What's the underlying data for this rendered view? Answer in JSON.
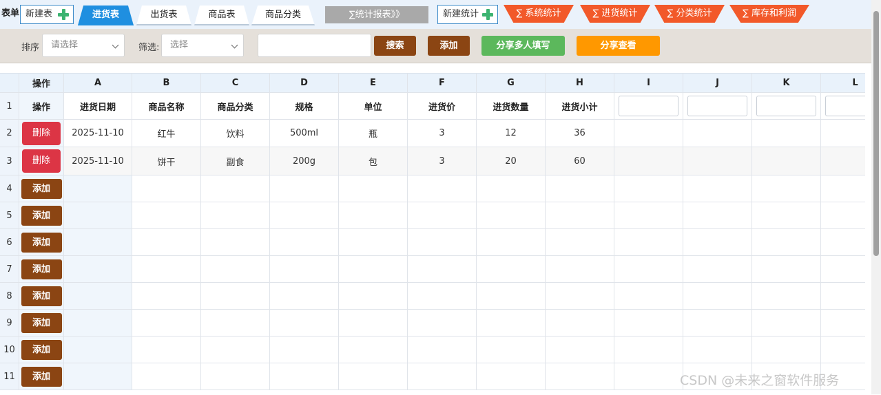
{
  "topbar": {
    "label": "表单",
    "new_table": "新建表",
    "tabs": [
      "进货表",
      "出货表",
      "商品表",
      "商品分类"
    ],
    "report_tab": "∑统计报表》》",
    "new_stat": "新建统计",
    "stats": [
      "∑ 系统统计",
      "∑ 进货统计",
      "∑ 分类统计",
      "∑ 库存和利润"
    ],
    "colors": {
      "active_tab": "#1f8fe0",
      "stat": "#f2592a",
      "report": "#a9a9a9"
    }
  },
  "toolbar": {
    "sort_label": "排序",
    "sort_placeholder": "请选择",
    "filter_label": "筛选:",
    "filter_placeholder": "选择",
    "search_value": "",
    "search_btn": "搜索",
    "add_btn": "添加",
    "share_fill_btn": "分享多人填写",
    "share_view_btn": "分享查看",
    "colors": {
      "brown": "#8b4513",
      "green": "#5cb85c",
      "orange": "#ff9800"
    }
  },
  "grid": {
    "letters": [
      "操作",
      "A",
      "B",
      "C",
      "D",
      "E",
      "F",
      "G",
      "H",
      "I",
      "J",
      "K",
      "L"
    ],
    "row1_num": "1",
    "fields": [
      "操作",
      "进货日期",
      "商品名称",
      "商品分类",
      "规格",
      "单位",
      "进货价",
      "进货数量",
      "进货小计"
    ],
    "rows": [
      {
        "num": "2",
        "action": "删除",
        "cells": [
          "2025-11-10",
          "红牛",
          "饮料",
          "500ml",
          "瓶",
          "3",
          "12",
          "36"
        ]
      },
      {
        "num": "3",
        "action": "删除",
        "cells": [
          "2025-11-10",
          "饼干",
          "副食",
          "200g",
          "包",
          "3",
          "20",
          "60"
        ]
      }
    ],
    "empty_rows": [
      "4",
      "5",
      "6",
      "7",
      "8",
      "9",
      "10",
      "11"
    ],
    "empty_action": "添加"
  },
  "watermark": "CSDN @未来之窗软件服务"
}
